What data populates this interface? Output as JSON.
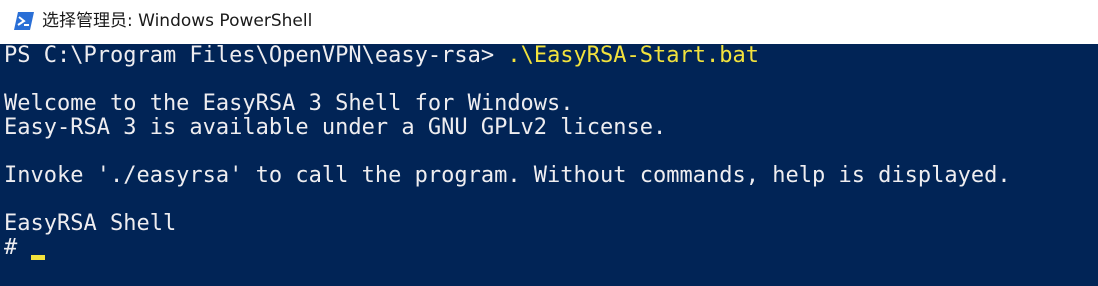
{
  "window": {
    "title": "选择管理员: Windows PowerShell",
    "icon": "powershell-icon"
  },
  "console": {
    "prompt": "PS C:\\Program Files\\OpenVPN\\easy-rsa> ",
    "command": ".\\EasyRSA-Start.bat",
    "output": [
      "Welcome to the EasyRSA 3 Shell for Windows.",
      "Easy-RSA 3 is available under a GNU GPLv2 license.",
      "",
      "Invoke './easyrsa' to call the program. Without commands, help is displayed.",
      "",
      "EasyRSA Shell"
    ],
    "shell_prompt": "#"
  },
  "colors": {
    "console_background": "#012456",
    "console_text": "#eeedf0",
    "command_text": "#f2e23d"
  }
}
